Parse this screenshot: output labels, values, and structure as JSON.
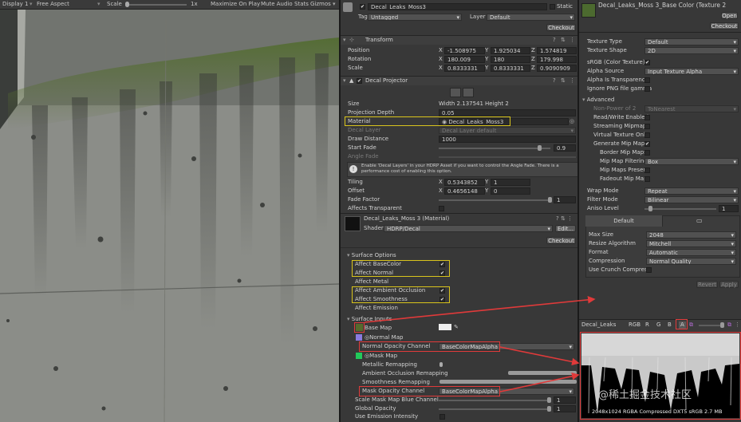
{
  "game_view": {
    "display": "Display 1",
    "aspect": "Free Aspect",
    "scale_label": "Scale",
    "scale_value": "1x",
    "toggles": [
      "Maximize On Play",
      "Mute Audio",
      "Stats",
      "Gizmos"
    ]
  },
  "inspector": {
    "object_name": "Decal_Leaks_Moss3",
    "static_label": "Static",
    "tag_label": "Tag",
    "tag_value": "Untagged",
    "layer_label": "Layer",
    "layer_value": "Default",
    "checkout": "Checkout",
    "transform": {
      "title": "Transform",
      "position": {
        "label": "Position",
        "x": "-1.508975",
        "y": "1.925034",
        "z": "1.574819"
      },
      "rotation": {
        "label": "Rotation",
        "x": "180.009",
        "y": "180",
        "z": "179.998"
      },
      "scale": {
        "label": "Scale",
        "x": "0.8333331",
        "y": "0.8333331",
        "z": "0.9090909"
      }
    },
    "decal": {
      "title": "Decal Projector",
      "size_label": "Size",
      "size_w": "Width 2.137541",
      "size_h": "Height 2",
      "projection_depth_label": "Projection Depth",
      "projection_depth": "0.05",
      "material_label": "Material",
      "material_value": "Decal_Leaks_Moss3",
      "decal_layer_label": "Decal Layer",
      "decal_layer_value": "Decal Layer default",
      "draw_distance_label": "Draw Distance",
      "draw_distance": "1000",
      "start_fade_label": "Start Fade",
      "start_fade": "0.9",
      "angle_fade_label": "Angle Fade",
      "info_text": "Enable 'Decal Layers' in your HDRP Asset if you want to control the Angle Fade. There is a performance cost of enabling this option.",
      "tiling_label": "Tiling",
      "tiling_x": "0.5343852",
      "tiling_y": "1",
      "offset_label": "Offset",
      "offset_x": "0.4656148",
      "offset_y": "0",
      "fade_factor_label": "Fade Factor",
      "fade_factor": "1",
      "affects_transparent_label": "Affects Transparent"
    },
    "material": {
      "title": "Decal_Leaks_Moss 3 (Material)",
      "shader_label": "Shader",
      "shader_value": "HDRP/Decal",
      "edit": "Edit...",
      "checkout": "Checkout",
      "surface_options": "Surface Options",
      "affect_basecolor": "Affect BaseColor",
      "affect_normal": "Affect Normal",
      "affect_metal": "Affect Metal",
      "affect_ao": "Affect Ambient Occlusion",
      "affect_smoothness": "Affect Smoothness",
      "affect_emission": "Affect Emission",
      "surface_inputs": "Surface Inputs",
      "base_map": "Base Map",
      "normal_map": "Normal Map",
      "normal_opacity_label": "Normal Opacity Channel",
      "normal_opacity_value": "BaseColorMapAlpha",
      "mask_map": "Mask Map",
      "metallic_remapping": "Metallic Remapping",
      "ao_remapping": "Ambient Occlusion Remapping",
      "smoothness_remapping": "Smoothness Remapping",
      "mask_opacity_label": "Mask Opacity Channel",
      "mask_opacity_value": "BaseColorMapAlpha",
      "scale_mask_label": "Scale Mask Map Blue Channel",
      "scale_mask_value": "1",
      "global_opacity_label": "Global Opacity",
      "global_opacity_value": "1",
      "use_emission_label": "Use Emission Intensity"
    }
  },
  "texture": {
    "title": "Decal_Leaks_Moss 3_Base Color (Texture 2",
    "open": "Open",
    "checkout": "Checkout",
    "texture_type_label": "Texture Type",
    "texture_type": "Default",
    "texture_shape_label": "Texture Shape",
    "texture_shape": "2D",
    "srgb_label": "sRGB (Color Texture)",
    "alpha_source_label": "Alpha Source",
    "alpha_source": "Input Texture Alpha",
    "alpha_transparency_label": "Alpha Is Transparency",
    "ignore_png_label": "Ignore PNG file gamma",
    "advanced": "Advanced",
    "npot_label": "Non-Power of 2",
    "npot_value": "ToNearest",
    "read_write_label": "Read/Write Enabled",
    "streaming_label": "Streaming Mipmaps",
    "virtual_label": "Virtual Texture Only",
    "gen_mip_label": "Generate Mip Maps",
    "border_mip_label": "Border Mip Maps",
    "mip_filter_label": "Mip Map Filtering",
    "mip_filter": "Box",
    "mip_preserve_label": "Mip Maps Preser",
    "fadeout_label": "Fadeout Mip Map",
    "wrap_label": "Wrap Mode",
    "wrap": "Repeat",
    "filter_label": "Filter Mode",
    "filter": "Bilinear",
    "aniso_label": "Aniso Level",
    "aniso": "1",
    "platform_tab": "Default",
    "max_size_label": "Max Size",
    "max_size": "2048",
    "resize_label": "Resize Algorithm",
    "resize": "Mitchell",
    "format_label": "Format",
    "format": "Automatic",
    "compression_label": "Compression",
    "compression": "Normal Quality",
    "crunch_label": "Use Crunch Compress",
    "revert": "Revert",
    "apply": "Apply",
    "preview_name": "Decal_Leaks",
    "channels": [
      "RGB",
      "R",
      "G",
      "B",
      "A"
    ],
    "preview_info": "2048x1024  RGBA Compressed DXT5 sRGB  2.7 MB",
    "watermark": "@稀土掘金技术社区"
  },
  "colors": {
    "highlight_yellow": "#d9c41c",
    "highlight_red": "#e03a3a",
    "panel": "#383838"
  }
}
